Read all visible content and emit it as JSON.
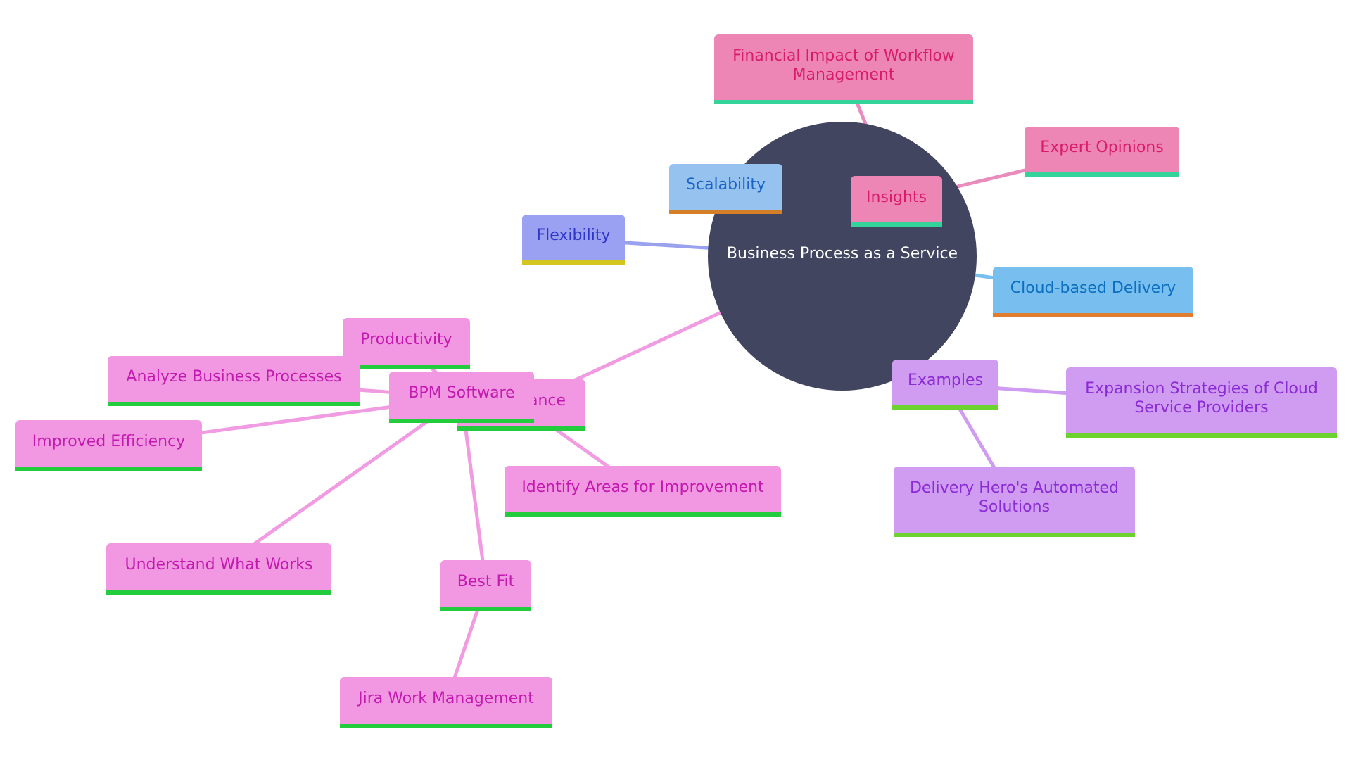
{
  "diagram": {
    "type": "mindmap",
    "root": {
      "id": "root",
      "label": "Business Process as a Service"
    },
    "colors": {
      "root_fill": "#414560",
      "root_text": "#ffffff",
      "insights_fill": "#ee86b5",
      "insights_text": "#d81b6a",
      "insights_border": "#34d399",
      "insights_edge": "#e98bbd",
      "scalability_fill": "#96c2f0",
      "scalability_text": "#1b63c4",
      "scalability_border": "#d47f27",
      "flexibility_fill": "#9aa1f2",
      "flexibility_text": "#2f36c7",
      "flexibility_border": "#d4c51f",
      "flexibility_edge": "#9aa1ee",
      "cloud_fill": "#78bff0",
      "cloud_text": "#0c6fbf",
      "cloud_border": "#e07d2e",
      "cloud_edge": "#78bff0",
      "examples_fill": "#cf9cf2",
      "examples_text": "#8a2bd4",
      "examples_border": "#6dd12e",
      "examples_edge": "#cf9cf2",
      "importance_fill": "#f298e2",
      "importance_text": "#c21aaf",
      "importance_border": "#22cc3c",
      "importance_edge": "#f09be2"
    },
    "nodes": [
      {
        "id": "financial",
        "label": "Financial Impact of Workflow Management",
        "parent": "insights",
        "group": "insights"
      },
      {
        "id": "expert",
        "label": "Expert Opinions",
        "parent": "insights",
        "group": "insights"
      },
      {
        "id": "insights",
        "label": "Insights",
        "parent": "root",
        "group": "insights"
      },
      {
        "id": "scalability",
        "label": "Scalability",
        "parent": "root",
        "group": "scalability"
      },
      {
        "id": "flexibility",
        "label": "Flexibility",
        "parent": "root",
        "group": "flexibility"
      },
      {
        "id": "cloud",
        "label": "Cloud-based Delivery",
        "parent": "root",
        "group": "cloud"
      },
      {
        "id": "examples",
        "label": "Examples",
        "parent": "root",
        "group": "examples"
      },
      {
        "id": "expansion",
        "label": "Expansion Strategies of Cloud Service Providers",
        "parent": "examples",
        "group": "examples"
      },
      {
        "id": "deliveryhero",
        "label": "Delivery Hero's Automated Solutions",
        "parent": "examples",
        "group": "examples"
      },
      {
        "id": "importance",
        "label": "Importance",
        "parent": "root",
        "group": "importance"
      },
      {
        "id": "bpm",
        "label": "BPM Software",
        "parent": "importance",
        "group": "importance"
      },
      {
        "id": "productivity",
        "label": "Productivity",
        "parent": "bpm",
        "group": "importance"
      },
      {
        "id": "analyze",
        "label": "Analyze Business Processes",
        "parent": "bpm",
        "group": "importance"
      },
      {
        "id": "efficiency",
        "label": "Improved Efficiency",
        "parent": "bpm",
        "group": "importance"
      },
      {
        "id": "identify",
        "label": "Identify Areas for Improvement",
        "parent": "importance",
        "group": "importance"
      },
      {
        "id": "understand",
        "label": "Understand What Works",
        "parent": "bpm",
        "group": "importance"
      },
      {
        "id": "bestfit",
        "label": "Best Fit",
        "parent": "bpm",
        "group": "importance"
      },
      {
        "id": "jira",
        "label": "Jira Work Management",
        "parent": "bestfit",
        "group": "importance"
      }
    ]
  }
}
